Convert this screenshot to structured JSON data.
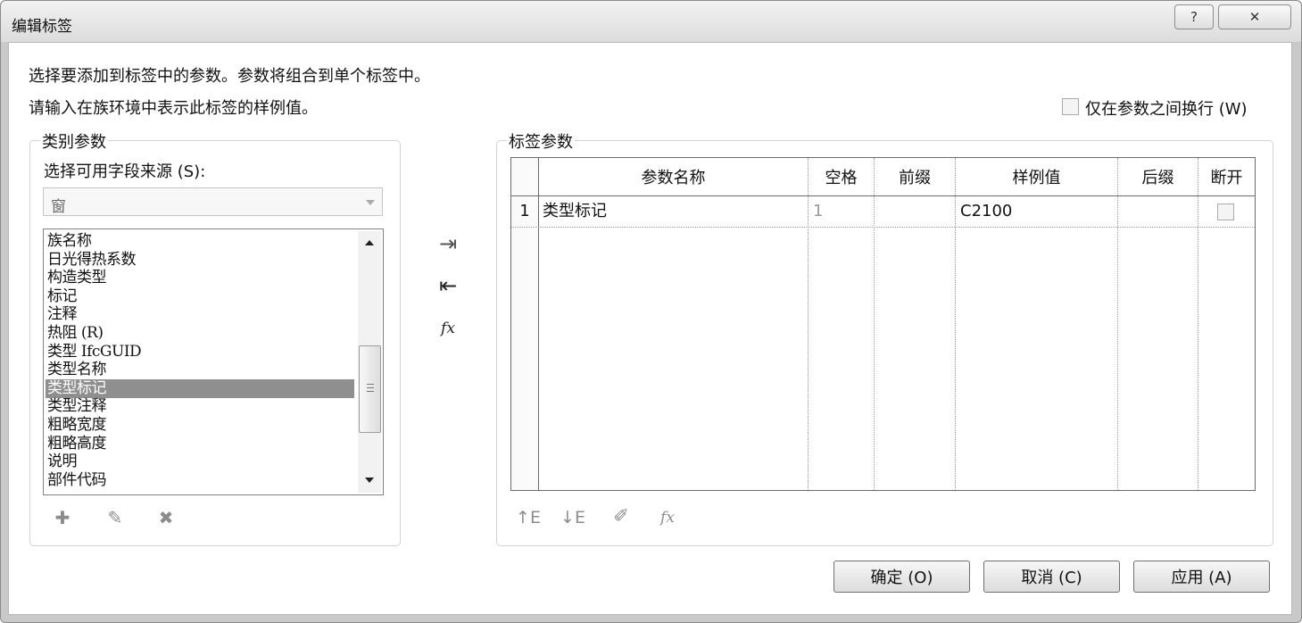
{
  "dialog": {
    "title": "编辑标签",
    "help_label": "?",
    "close_label": "✕"
  },
  "instructions": {
    "line1": "选择要添加到标签中的参数。参数将组合到单个标签中。",
    "line2": "请输入在族环境中表示此标签的样例值。"
  },
  "wrap_option": {
    "label": "仅在参数之间换行 (W)",
    "checked": false
  },
  "category_panel": {
    "group_label": "类别参数",
    "source_label": "选择可用字段来源 (S):",
    "source_value": "窗",
    "fields": [
      "族名称",
      "日光得热系数",
      "构造类型",
      "标记",
      "注释",
      "热阻 (R)",
      "类型 IfcGUID",
      "类型名称",
      "类型标记",
      "类型注释",
      "粗略宽度",
      "粗略高度",
      "说明",
      "部件代码"
    ],
    "selected_field": "类型标记",
    "tools": [
      {
        "name": "new-parameter-icon",
        "glyph": "✚"
      },
      {
        "name": "edit-parameter-icon",
        "glyph": "✎"
      },
      {
        "name": "delete-parameter-icon",
        "glyph": "✖"
      }
    ]
  },
  "transfer": {
    "add_icon": "⇥",
    "remove_icon": "⇤",
    "formula_label": "fx"
  },
  "label_panel": {
    "group_label": "标签参数",
    "columns": [
      "参数名称",
      "空格",
      "前缀",
      "样例值",
      "后缀",
      "断开"
    ],
    "rows": [
      {
        "index": "1",
        "name": "类型标记",
        "spaces": "1",
        "prefix": "",
        "sample": "C2100",
        "suffix": "",
        "break": false
      }
    ],
    "tools": [
      {
        "name": "move-up-icon",
        "glyph": "↑E"
      },
      {
        "name": "move-down-icon",
        "glyph": "↓E"
      },
      {
        "name": "edit-label-icon",
        "glyph": "✐"
      },
      {
        "name": "formula-icon",
        "glyph": "fx"
      }
    ]
  },
  "buttons": {
    "ok": "确定 (O)",
    "cancel": "取消 (C)",
    "apply": "应用 (A)"
  }
}
